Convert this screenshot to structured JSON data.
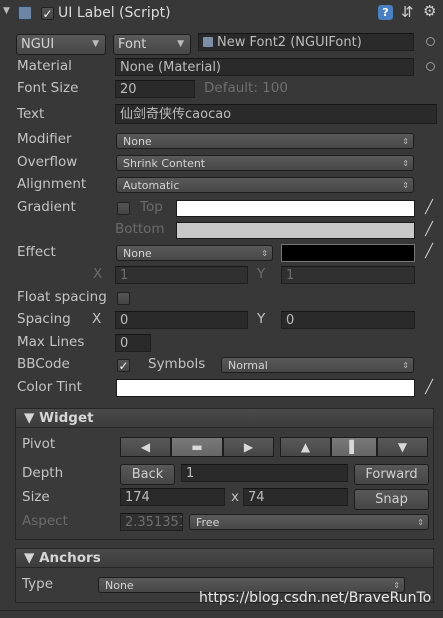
{
  "component": {
    "title": "UI Label (Script)",
    "enabled": true,
    "icon_names": [
      "collapse-arrow-icon",
      "script-icon",
      "help-icon",
      "preset-icon",
      "gear-icon"
    ]
  },
  "font_row": {
    "font_type": "NGUI",
    "font_kind": "Font",
    "font_asset": "New Font2 (NGUIFont)"
  },
  "material": {
    "label": "Material",
    "value": "None (Material)"
  },
  "font_size": {
    "label": "Font Size",
    "value": "20",
    "default_text": "Default: 100"
  },
  "text": {
    "label": "Text",
    "value": "仙剑奇侠传caocao"
  },
  "modifier": {
    "label": "Modifier",
    "value": "None"
  },
  "overflow": {
    "label": "Overflow",
    "value": "Shrink Content"
  },
  "alignment": {
    "label": "Alignment",
    "value": "Automatic"
  },
  "gradient": {
    "label": "Gradient",
    "enabled": false,
    "top_label": "Top",
    "bottom_label": "Bottom",
    "top_color": "#ffffff",
    "bottom_color": "#c8c8c8"
  },
  "effect": {
    "label": "Effect",
    "value": "None",
    "color": "#000000",
    "x_label": "X",
    "x_value": "1",
    "y_label": "Y",
    "y_value": "1"
  },
  "float_spacing": {
    "label": "Float spacing",
    "enabled": false
  },
  "spacing": {
    "label": "Spacing",
    "x_label": "X",
    "x_value": "0",
    "y_label": "Y",
    "y_value": "0"
  },
  "max_lines": {
    "label": "Max Lines",
    "value": "0"
  },
  "bbcode": {
    "label": "BBCode",
    "enabled": true,
    "symbols_label": "Symbols",
    "symbols_value": "Normal"
  },
  "color_tint": {
    "label": "Color Tint",
    "color": "#ffffff"
  },
  "widget": {
    "title": "Widget",
    "pivot_label": "Pivot",
    "pivot_h": [
      "◀",
      "▬",
      "▶"
    ],
    "pivot_v": [
      "▲",
      "▌",
      "▼"
    ],
    "depth_label": "Depth",
    "back_label": "Back",
    "depth_value": "1",
    "forward_label": "Forward",
    "size_label": "Size",
    "width": "174",
    "x_sep": "x",
    "height": "74",
    "snap_label": "Snap",
    "aspect_label": "Aspect",
    "aspect_value": "2.351351",
    "aspect_mode": "Free"
  },
  "anchors": {
    "title": "Anchors",
    "type_label": "Type",
    "type_value": "None"
  },
  "watermark": "https://blog.csdn.net/BraveRunTo",
  "colors": {
    "background": "#383838",
    "field": "#2a2a2a"
  }
}
